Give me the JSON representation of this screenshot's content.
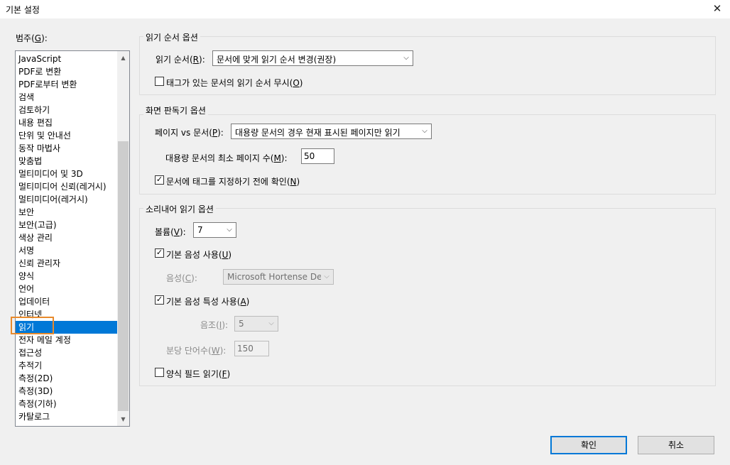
{
  "window": {
    "title": "기본 설정",
    "close_glyph": "✕"
  },
  "category": {
    "label": "범주",
    "mnemonic": "G",
    "items": [
      "JavaScript",
      "PDF로 변환",
      "PDF로부터 변환",
      "검색",
      "검토하기",
      "내용 편집",
      "단위 및 안내선",
      "동작 마법사",
      "맞춤법",
      "멀티미디어 및 3D",
      "멀티미디어 신뢰(레거시)",
      "멀티미디어(레거시)",
      "보안",
      "보안(고급)",
      "색상 관리",
      "서명",
      "신뢰 관리자",
      "양식",
      "언어",
      "업데이터",
      "인터넷",
      "읽기",
      "전자 메일 계정",
      "접근성",
      "추적기",
      "측정(2D)",
      "측정(3D)",
      "측정(기하)",
      "카탈로그"
    ],
    "selected_index": 21,
    "scroll_up_glyph": "▲",
    "scroll_down_glyph": "▼"
  },
  "reading_order": {
    "group_title": "읽기 순서 옵션",
    "order_label": "읽기 순서",
    "order_mnemonic": "R",
    "order_value": "문서에 맞게 읽기 순서 변경(권장)",
    "ignore_tagged_label": "태그가 있는 문서의 읽기 순서 무시",
    "ignore_tagged_mnemonic": "O",
    "ignore_tagged_checked": false
  },
  "screen_reader": {
    "group_title": "화면 판독기 옵션",
    "pages_label": "페이지 vs 문서",
    "pages_mnemonic": "P",
    "pages_value": "대용량 문서의 경우 현재 표시된 페이지만 읽기",
    "min_pages_label": "대용량 문서의 최소 페이지 수",
    "min_pages_mnemonic": "M",
    "min_pages_value": "50",
    "confirm_label": "문서에 태그를 지정하기 전에 확인",
    "confirm_mnemonic": "N",
    "confirm_checked": true
  },
  "read_aloud": {
    "group_title": "소리내어 읽기 옵션",
    "volume_label": "볼륨",
    "volume_mnemonic": "V",
    "volume_value": "7",
    "default_voice_label": "기본 음성 사용",
    "default_voice_mnemonic": "U",
    "default_voice_checked": true,
    "voice_label": "음성",
    "voice_mnemonic": "C",
    "voice_value": "Microsoft Hortense Deskt",
    "default_voice_props_label": "기본 음성 특성 사용",
    "default_voice_props_mnemonic": "A",
    "default_voice_props_checked": true,
    "pitch_label": "음조",
    "pitch_mnemonic": "I",
    "pitch_value": "5",
    "wpm_label": "분당 단어수",
    "wpm_mnemonic": "W",
    "wpm_value": "150",
    "form_fields_label": "양식 필드 읽기",
    "form_fields_mnemonic": "F",
    "form_fields_checked": false
  },
  "buttons": {
    "ok": "확인",
    "cancel": "취소"
  },
  "glyphs": {
    "combo_arrow": "⌵",
    "check": "✓"
  }
}
